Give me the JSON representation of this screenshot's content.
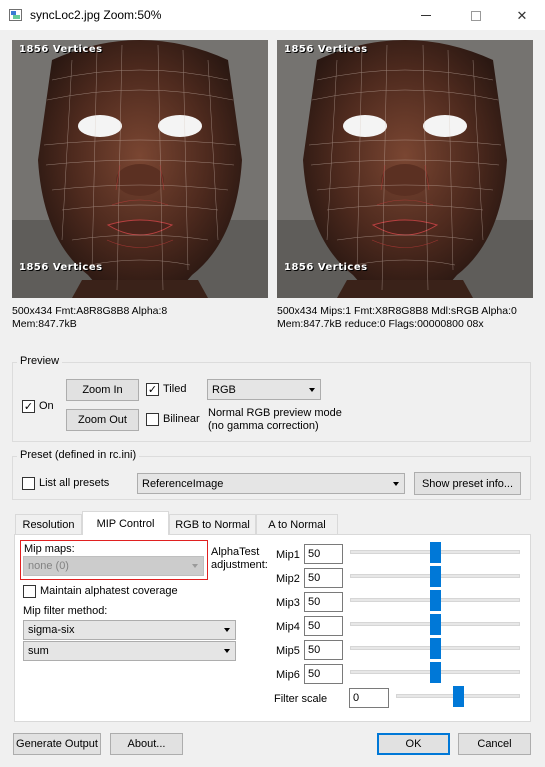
{
  "window": {
    "title": "syncLoc2.jpg  Zoom:50%",
    "minimize_glyph": "",
    "maximize_glyph": "",
    "close_glyph": "✕"
  },
  "previews": {
    "left": {
      "top_label": "1856 Vertices",
      "bottom_label": "1856 Vertices",
      "info_line1": "500x434 Fmt:A8R8G8B8 Alpha:8",
      "info_line2": "Mem:847.7kB"
    },
    "right": {
      "top_label": "1856 Vertices",
      "bottom_label": "1856 Vertices",
      "info_line1": "500x434 Mips:1 Fmt:X8R8G8B8 Mdl:sRGB Alpha:0",
      "info_line2": "Mem:847.7kB reduce:0 Flags:00000800  08x"
    }
  },
  "preview_group": {
    "title": "Preview",
    "on_label": "On",
    "on_checked": true,
    "zoom_in_label": "Zoom In",
    "zoom_out_label": "Zoom Out",
    "tiled_label": "Tiled",
    "tiled_checked": true,
    "bilinear_label": "Bilinear",
    "bilinear_checked": false,
    "mode_value": "RGB",
    "mode_desc_line1": "Normal RGB preview mode",
    "mode_desc_line2": "(no gamma correction)"
  },
  "preset_group": {
    "title": "Preset (defined in rc.ini)",
    "list_all_label": "List all presets",
    "list_all_checked": false,
    "preset_value": "ReferenceImage",
    "show_info_label": "Show preset info..."
  },
  "tabs": [
    {
      "label": "Resolution",
      "active": false
    },
    {
      "label": "MIP Control",
      "active": true
    },
    {
      "label": "RGB to Normal",
      "active": false
    },
    {
      "label": "A to Normal",
      "active": false
    }
  ],
  "mip_control": {
    "mip_maps_label": "Mip maps:",
    "mip_maps_value": "none (0)",
    "alphatest_label_line1": "AlphaTest",
    "alphatest_label_line2": "adjustment:",
    "maintain_label": "Maintain alphatest coverage",
    "maintain_checked": false,
    "filter_method_label": "Mip filter method:",
    "filter_method_value": "sigma-six",
    "filter_combine_value": "sum",
    "mips": [
      {
        "label": "Mip1",
        "value": "50",
        "level": 0.5
      },
      {
        "label": "Mip2",
        "value": "50",
        "level": 0.5
      },
      {
        "label": "Mip3",
        "value": "50",
        "level": 0.5
      },
      {
        "label": "Mip4",
        "value": "50",
        "level": 0.5
      },
      {
        "label": "Mip5",
        "value": "50",
        "level": 0.5
      },
      {
        "label": "Mip6",
        "value": "50",
        "level": 0.5
      }
    ],
    "filter_scale_label": "Filter scale",
    "filter_scale_value": "0",
    "filter_scale_level": 0.5
  },
  "footer": {
    "generate_label": "Generate Output",
    "about_label": "About...",
    "ok_label": "OK",
    "cancel_label": "Cancel"
  },
  "colors": {
    "accent": "#0078d7",
    "highlight": "#e02020"
  }
}
